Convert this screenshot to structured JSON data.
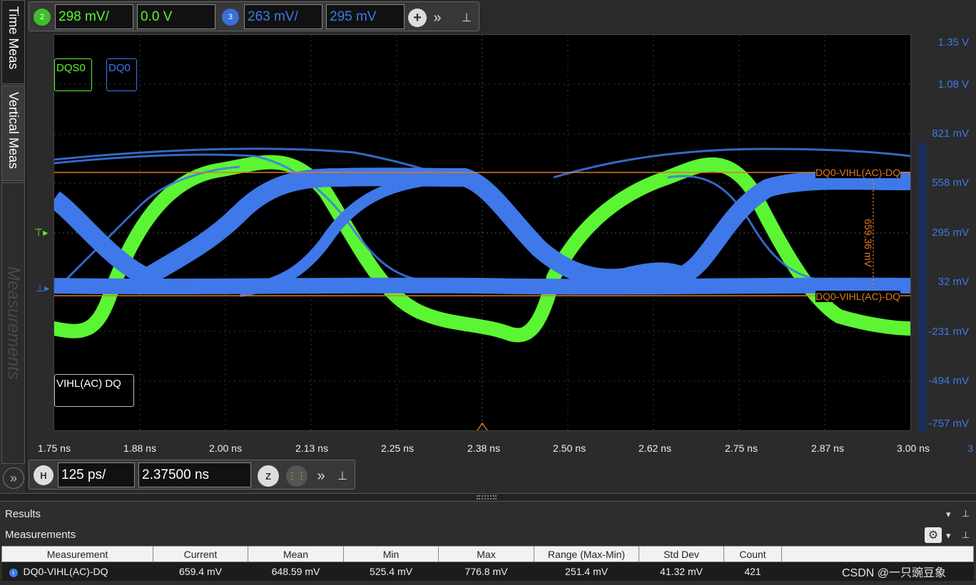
{
  "side_tabs": {
    "time_meas": "Time Meas",
    "vertical_meas": "Vertical Meas",
    "measurements": "Measurements",
    "expand_icon": "»"
  },
  "channel_toolbar": {
    "ch2": {
      "number": "2",
      "scale": "298 mV/",
      "offset": "0.0 V",
      "color": "#5cf533"
    },
    "ch3": {
      "number": "3",
      "scale": "263 mV/",
      "offset": "295 mV",
      "color": "#3f78e8"
    },
    "add_icon": "+",
    "more_icon": "»",
    "pin_icon": "⊥"
  },
  "waveform_tags": {
    "dqs0": "DQS0",
    "dq0": "DQ0",
    "measurement_tag": "VIHL(AC) DQ"
  },
  "cursors": {
    "upper_label": "DQ0-VIHL(AC)-DQ",
    "lower_label": "DQ0-VIHL(AC)-DQ",
    "delta_label": "659.36 mV",
    "color": "#e07820"
  },
  "y_axis_labels": [
    "1.35 V",
    "1.08 V",
    "821 mV",
    "558 mV",
    "295 mV",
    "32 mV",
    "-231 mV",
    "-494 mV",
    "-757 mV"
  ],
  "x_axis_labels": [
    "1.75 ns",
    "1.88 ns",
    "2.00 ns",
    "2.13 ns",
    "2.25 ns",
    "2.38 ns",
    "2.50 ns",
    "2.62 ns",
    "2.75 ns",
    "2.87 ns",
    "3.00 ns"
  ],
  "x_axis_edge_text": "3",
  "horizontal_toolbar": {
    "h_label": "H",
    "timebase": "125 ps/",
    "position": "2.37500 ns",
    "zoom_icon": "Z",
    "more_icon": "»",
    "pin_icon": "⊥"
  },
  "results_panel": {
    "title": "Results",
    "subtitle": "Measurements",
    "columns": [
      "Measurement",
      "Current",
      "Mean",
      "Min",
      "Max",
      "Range (Max-Min)",
      "Std Dev",
      "Count"
    ],
    "rows": [
      [
        "DQ0-VIHL(AC)-DQ",
        "659.4 mV",
        "648.59 mV",
        "525.4 mV",
        "776.8 mV",
        "251.4 mV",
        "41.32 mV",
        "421"
      ]
    ]
  },
  "watermark": "CSDN @一只豌豆象"
}
